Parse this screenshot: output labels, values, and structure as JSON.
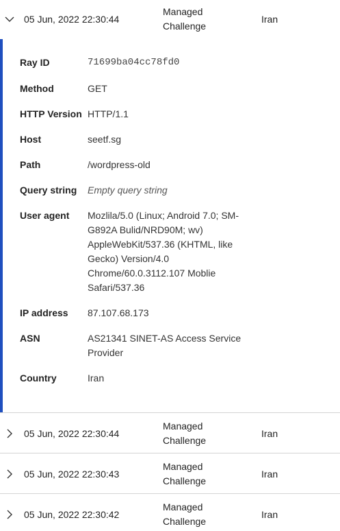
{
  "expanded_event": {
    "time": "05 Jun, 2022 22:30:44",
    "action": "Managed Challenge",
    "country": "Iran",
    "details": [
      {
        "label": "Ray ID",
        "value": "71699ba04cc78fd0"
      },
      {
        "label": "Method",
        "value": "GET"
      },
      {
        "label": "HTTP Version",
        "value": "HTTP/1.1"
      },
      {
        "label": "Host",
        "value": "seetf.sg"
      },
      {
        "label": "Path",
        "value": "/wordpress-old"
      },
      {
        "label": "Query string",
        "value": "Empty query string"
      },
      {
        "label": "User agent",
        "value": "Mozlila/5.0 (Linux; Android 7.0; SM-G892A Bulid/NRD90M; wv) AppleWebKit/537.36 (KHTML, like Gecko) Version/4.0 Chrome/60.0.3112.107 Moblie Safari/537.36"
      },
      {
        "label": "IP address",
        "value": "87.107.68.173"
      },
      {
        "label": "ASN",
        "value": "AS21341 SINET-AS Access Service Provider"
      },
      {
        "label": "Country",
        "value": "Iran"
      }
    ]
  },
  "events": [
    {
      "time": "05 Jun, 2022 22:30:44",
      "action": "Managed Challenge",
      "country": "Iran"
    },
    {
      "time": "05 Jun, 2022 22:30:43",
      "action": "Managed Challenge",
      "country": "Iran"
    },
    {
      "time": "05 Jun, 2022 22:30:42",
      "action": "Managed Challenge",
      "country": "Iran"
    }
  ],
  "icons": {
    "expanded": "chevron-down-icon",
    "collapsed": "chevron-right-icon"
  },
  "colors": {
    "accent_bar": "#1f4fbf",
    "divider": "#d4d4d4"
  }
}
